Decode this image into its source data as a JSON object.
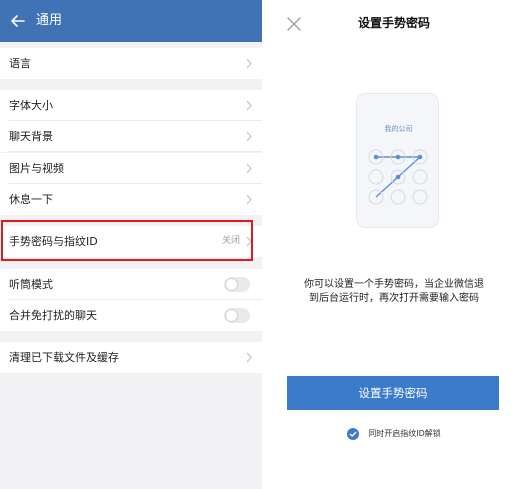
{
  "left_screen": {
    "header_title": "通用",
    "rows": {
      "language": {
        "label": "语言"
      },
      "font_size": {
        "label": "字体大小"
      },
      "chat_background": {
        "label": "聊天背景"
      },
      "images_videos": {
        "label": "图片与视频"
      },
      "take_a_break": {
        "label": "休息一下"
      },
      "gesture_password": {
        "label": "手势密码与指纹ID",
        "value": "关闭"
      },
      "earpiece_mode": {
        "label": "听筒模式",
        "toggle_on": false
      },
      "merge_muted_chats": {
        "label": "合并免打扰的聊天",
        "toggle_on": false
      },
      "clear_cache": {
        "label": "清理已下载文件及缓存"
      }
    },
    "highlight_color": "#e11b1b",
    "header_color": "#3f73b6"
  },
  "right_screen": {
    "title": "设置手势密码",
    "illustration_label": "我的公司",
    "description_line1": "你可以设置一个手势密码，当企业微信退",
    "description_line2": "到后台运行时，再次打开需要输入密码",
    "primary_button": "设置手势密码",
    "fingerprint_option": {
      "label": "同时开启指纹ID解锁",
      "checked": true
    },
    "accent_color": "#3b7bc9"
  }
}
